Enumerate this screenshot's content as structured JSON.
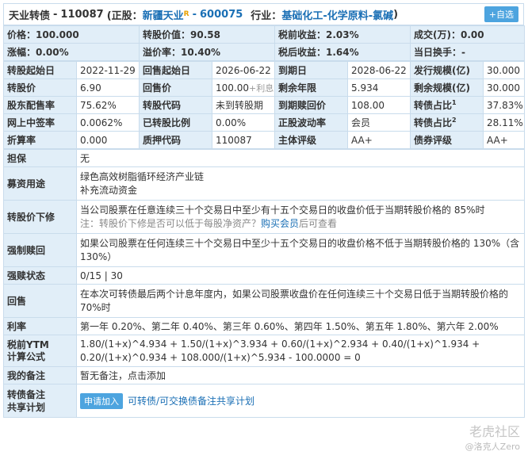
{
  "header": {
    "name": "天业转债",
    "code": "110087",
    "stock_prefix": "(正股：",
    "stock_name": "新疆天业",
    "r_badge": "R",
    "stock_code": "600075",
    "industry_prefix": "行业：",
    "industry": "基础化工-化学原料-氯碱",
    "close_paren": ")",
    "add_label": "+自选"
  },
  "rows": [
    {
      "label": "价格：",
      "value": "100.000",
      "label2": "转股价值：",
      "value2": "90.58",
      "label3": "税前收益：",
      "value3": "2.03%",
      "label4": "成交(万)：",
      "value4": "0.00"
    },
    {
      "label": "涨幅：",
      "value": "0.00%",
      "label2": "溢价率：",
      "value2": "10.40%",
      "label3": "税后收益：",
      "value3": "1.64%",
      "label4": "当日换手：",
      "value4": "-"
    }
  ],
  "grid": {
    "r1": {
      "a": "转股起始日",
      "av": "2022-11-29",
      "b": "回售起始日",
      "bv": "2026-06-22",
      "c": "到期日",
      "cv": "2028-06-22",
      "d": "发行规模(亿)",
      "dv": "30.000"
    },
    "r2": {
      "a": "转股价",
      "av": "6.90",
      "b": "回售价",
      "bv": "100.00",
      "bv_extra": "+利息",
      "c": "剩余年限",
      "cv": "5.934",
      "d": "剩余规模(亿)",
      "dv": "30.000"
    },
    "r3": {
      "a": "股东配售率",
      "av": "75.62%",
      "b": "转股代码",
      "bv": "未到转股期",
      "c": "到期赎回价",
      "cv": "108.00",
      "d": "转债占比",
      "d_sup": "1",
      "dv": "37.83%"
    },
    "r4": {
      "a": "网上中签率",
      "av": "0.0062%",
      "b": "已转股比例",
      "bv": "0.00%",
      "c": "正股波动率",
      "cv": "会员",
      "d": "转债占比",
      "d_sup": "2",
      "dv": "28.11%"
    },
    "r5": {
      "a": "折算率",
      "av": "0.000",
      "b": "质押代码",
      "bv": "110087",
      "c": "主体评级",
      "cv": "AA+",
      "d": "债券评级",
      "dv": "AA+"
    }
  },
  "details": {
    "guarantee_label": "担保",
    "guarantee": "无",
    "funds_label": "募资用途",
    "funds_1": "绿色高效树脂循环经济产业链",
    "funds_2": "补充流动资金",
    "reset_label": "转股价下修",
    "reset_1": "当公司股票在任意连续三十个交易日中至少有十五个交易日的收盘价低于当期转股价格的 85%时",
    "reset_note_prefix": "注：转股价下修是否可以低于每股净资产？",
    "reset_note_link": "购买会员",
    "reset_note_suffix": "后可查看",
    "redeem_label": "强制赎回",
    "redeem": "如果公司股票在任何连续三十个交易日中至少十五个交易日的收盘价格不低于当期转股价格的 130%（含 130%）",
    "redeem_status_label": "强赎状态",
    "redeem_status": "0/15 | 30",
    "putback_label": "回售",
    "putback": "在本次可转债最后两个计息年度内，如果公司股票收盘价在任何连续三十个交易日低于当期转股价格的 70%时",
    "rate_label": "利率",
    "rate": "第一年 0.20%、第二年 0.40%、第三年 0.60%、第四年 1.50%、第五年 1.80%、第六年 2.00%",
    "ytm_label_1": "税前YTM",
    "ytm_label_2": "计算公式",
    "ytm_formula": "1.80/(1+x)^4.934 + 1.50/(1+x)^3.934 + 0.60/(1+x)^2.934 + 0.40/(1+x)^1.934 + 0.20/(1+x)^0.934 + 108.000/(1+x)^5.934 - 100.0000 = 0",
    "note_label": "我的备注",
    "note_link": "暂无备注，点击添加",
    "share_label_1": "转债备注",
    "share_label_2": "共享计划",
    "apply_btn": "申请加入",
    "share_link": "可转债/可交换债备注共享计划"
  },
  "watermark": {
    "main": "老虎社区",
    "sub": "@洛克人Zero"
  }
}
